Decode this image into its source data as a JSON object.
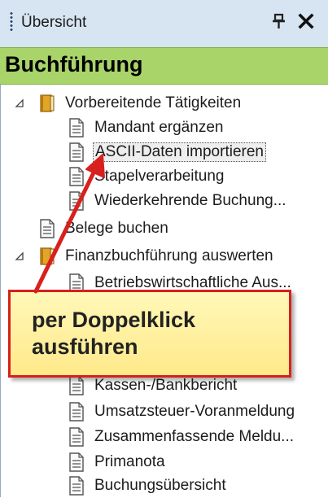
{
  "panel": {
    "title": "Übersicht",
    "pin_icon": "pin-icon",
    "close_icon": "close-icon"
  },
  "section": {
    "title": "Buchführung",
    "color": "#a8d46a"
  },
  "tree": {
    "items": [
      {
        "label": "Vorbereitende Tätigkeiten",
        "icon": "folder-icon",
        "expanded": true
      },
      {
        "label": "Mandant ergänzen",
        "icon": "document-icon"
      },
      {
        "label": "ASCII-Daten importieren",
        "icon": "document-icon",
        "selected": true
      },
      {
        "label": "Stapelverarbeitung",
        "icon": "document-icon"
      },
      {
        "label": "Wiederkehrende Buchung...",
        "icon": "document-icon"
      },
      {
        "label": "Belege buchen",
        "icon": "document-icon"
      },
      {
        "label": "Finanzbuchführung auswerten",
        "icon": "folder-icon",
        "expanded": true
      },
      {
        "label": "Betriebswirtschaftliche Aus...",
        "icon": "document-icon"
      },
      {
        "label": "Kassen-/Bankbericht",
        "icon": "document-icon"
      },
      {
        "label": "Umsatzsteuer-Voranmeldung",
        "icon": "document-icon"
      },
      {
        "label": "Zusammenfassende Meldu...",
        "icon": "document-icon"
      },
      {
        "label": "Primanota",
        "icon": "document-icon"
      },
      {
        "label": "Buchungsübersicht",
        "icon": "document-icon"
      }
    ]
  },
  "callout": {
    "text_line1": "per Doppelklick",
    "text_line2": "ausführen",
    "border_color": "#d8201d"
  }
}
